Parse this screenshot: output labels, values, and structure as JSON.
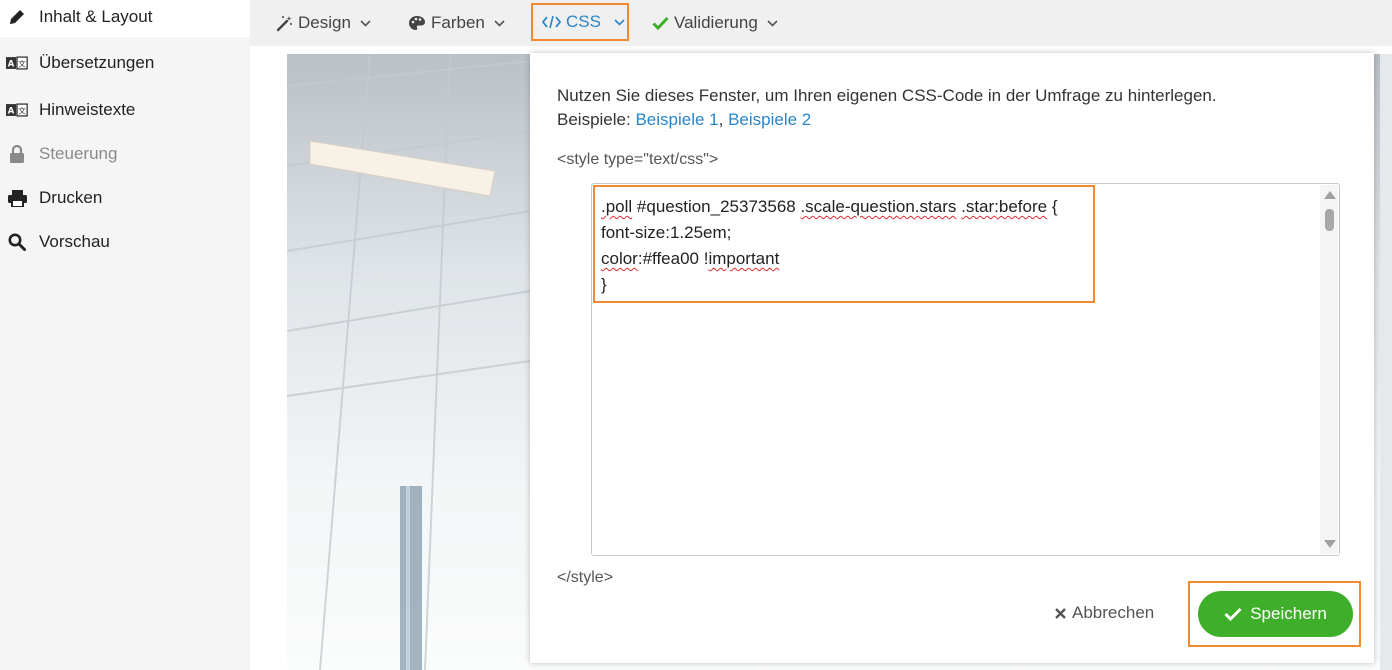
{
  "sidebar": {
    "items": [
      {
        "label": "Inhalt & Layout",
        "icon": "pencil-icon",
        "state": "active"
      },
      {
        "label": "Übersetzungen",
        "icon": "translate-icon",
        "state": "normal"
      },
      {
        "label": "Hinweistexte",
        "icon": "translate-icon",
        "state": "normal"
      },
      {
        "label": "Steuerung",
        "icon": "lock-icon",
        "state": "disabled"
      },
      {
        "label": "Drucken",
        "icon": "printer-icon",
        "state": "normal"
      },
      {
        "label": "Vorschau",
        "icon": "search-icon",
        "state": "normal"
      }
    ]
  },
  "toolbar": {
    "items": [
      {
        "label": "Design",
        "icon": "magic-wand-icon"
      },
      {
        "label": "Farben",
        "icon": "palette-icon"
      },
      {
        "label": "CSS",
        "icon": "code-icon",
        "active": true
      },
      {
        "label": "Validierung",
        "icon": "check-icon"
      }
    ]
  },
  "modal": {
    "intro_text": "Nutzen Sie dieses Fenster, um Ihren eigenen CSS-Code in der Umfrage zu hinterlegen.",
    "examples_prefix": "Beispiele: ",
    "example_1": "Beispiele 1",
    "example_sep": ", ",
    "example_2": "Beispiele 2",
    "style_open": "<style type=\"text/css\">",
    "style_close": "</style>",
    "code": {
      "l1_a": ".poll",
      "l1_b": " #question_25373568 ",
      "l1_c": ".scale-question.stars",
      "l1_d": " ",
      "l1_e": ".star:before",
      "l1_f": " {",
      "l2": "font-size:1.25em;",
      "l3_a": "color",
      "l3_b": ":#ffea00 !",
      "l3_c": "important",
      "l4": "}"
    },
    "cancel_label": "Abbrechen",
    "save_label": "Speichern"
  },
  "colors": {
    "accent": "#2a86c9",
    "highlight": "#f08a30",
    "save_green": "#3fae2a"
  }
}
